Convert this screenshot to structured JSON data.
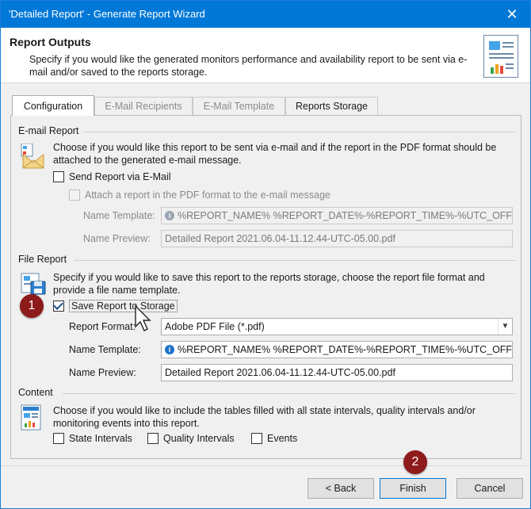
{
  "window": {
    "title": "'Detailed Report' - Generate Report Wizard",
    "close_glyph": "✕"
  },
  "header": {
    "title": "Report Outputs",
    "description": "Specify if you would like the generated monitors performance and availability report to be sent via e-mail and/or saved to the reports storage."
  },
  "tabs": [
    {
      "label": "Configuration",
      "state": "active"
    },
    {
      "label": "E-Mail Recipients",
      "state": "disabled"
    },
    {
      "label": "E-Mail Template",
      "state": "disabled"
    },
    {
      "label": "Reports Storage",
      "state": "enabled"
    }
  ],
  "email_report": {
    "section_title": "E-mail Report",
    "description": "Choose if you would like this report to be sent via e-mail and if the report in the PDF format should be attached to the generated e-mail message.",
    "send_via_email": {
      "label": "Send Report via E-Mail",
      "checked": false
    },
    "attach_pdf": {
      "label": "Attach a report in the PDF format to the e-mail message",
      "checked": false,
      "disabled": true
    },
    "name_template": {
      "label": "Name Template:",
      "value": "%REPORT_NAME% %REPORT_DATE%-%REPORT_TIME%-%UTC_OFFSET%..."
    },
    "name_preview": {
      "label": "Name Preview:",
      "value": "Detailed Report 2021.06.04-11.12.44-UTC-05.00.pdf"
    }
  },
  "file_report": {
    "section_title": "File Report",
    "description": "Specify if you would like to save this report to the reports storage, choose the report file format and provide a file name template.",
    "save_to_storage": {
      "label": "Save Report to Storage",
      "checked": true
    },
    "report_format": {
      "label": "Report Format:",
      "value": "Adobe PDF File (*.pdf)"
    },
    "name_template": {
      "label": "Name Template:",
      "value": "%REPORT_NAME% %REPORT_DATE%-%REPORT_TIME%-%UTC_OFFSET%.%"
    },
    "name_preview": {
      "label": "Name Preview:",
      "value": "Detailed Report 2021.06.04-11.12.44-UTC-05.00.pdf"
    }
  },
  "content": {
    "section_title": "Content",
    "description": "Choose if you would like to include the tables filled with all state intervals, quality intervals and/or monitoring events into this report.",
    "state_intervals": {
      "label": "State Intervals",
      "checked": false
    },
    "quality_intervals": {
      "label": "Quality Intervals",
      "checked": false
    },
    "events": {
      "label": "Events",
      "checked": false
    }
  },
  "markers": {
    "m1": "1",
    "m2": "2"
  },
  "buttons": {
    "back": "< Back",
    "finish": "Finish",
    "cancel": "Cancel"
  },
  "colors": {
    "titlebar": "#0078d7",
    "marker": "#8e1b1b",
    "info_icon": "#1e72c8"
  }
}
